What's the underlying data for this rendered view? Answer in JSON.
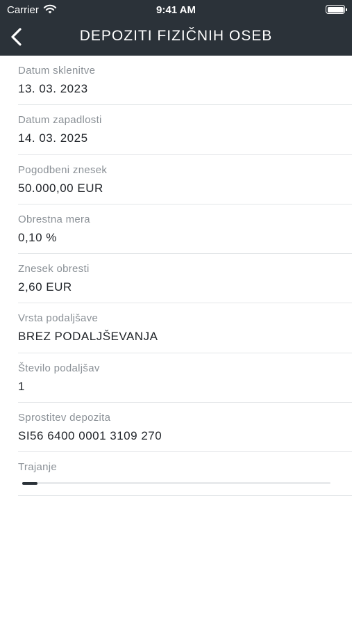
{
  "status_bar": {
    "carrier": "Carrier",
    "time": "9:41 AM"
  },
  "header": {
    "title": "DEPOZITI FIZIČNIH OSEB"
  },
  "fields": [
    {
      "label": "Datum sklenitve",
      "value": "13. 03. 2023"
    },
    {
      "label": "Datum zapadlosti",
      "value": "14. 03. 2025"
    },
    {
      "label": "Pogodbeni znesek",
      "value": "50.000,00 EUR"
    },
    {
      "label": "Obrestna mera",
      "value": "0,10 %"
    },
    {
      "label": "Znesek obresti",
      "value": "2,60 EUR"
    },
    {
      "label": "Vrsta podaljšave",
      "value": "BREZ PODALJŠEVANJA"
    },
    {
      "label": "Število podaljšav",
      "value": "1"
    },
    {
      "label": "Sprostitev depozita",
      "value": "SI56 6400 0001 3109 270"
    }
  ],
  "duration": {
    "label": "Trajanje",
    "progress": 0.05
  },
  "colors": {
    "header_bg": "#2b3239",
    "accent": "#2b3239"
  }
}
